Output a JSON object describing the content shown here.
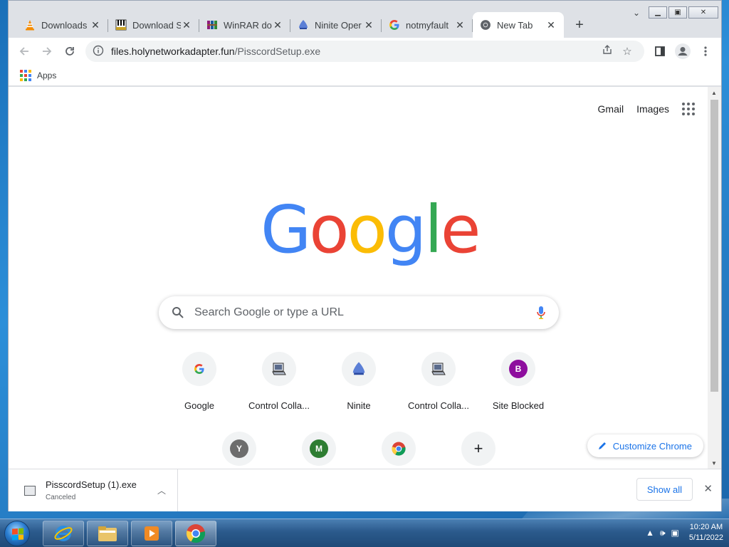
{
  "tabs": [
    {
      "title": "Downloads",
      "icon": "vlc-cone-icon",
      "active": false
    },
    {
      "title": "Download S",
      "icon": "piano-keys-icon",
      "active": false
    },
    {
      "title": "WinRAR dow",
      "icon": "winrar-books-icon",
      "active": false
    },
    {
      "title": "Ninite Oper",
      "icon": "ninite-icon",
      "active": false
    },
    {
      "title": "notmyfault",
      "icon": "google-g-icon",
      "active": false
    },
    {
      "title": "New Tab",
      "icon": "chrome-icon",
      "active": true
    }
  ],
  "tab_close_glyph": "✕",
  "new_tab_glyph": "+",
  "toolbar": {
    "url_host": "files.holynetworkadapter.fun",
    "url_path": "/PisscordSetup.exe"
  },
  "bookmarks": {
    "apps_label": "Apps"
  },
  "ntp": {
    "gmail": "Gmail",
    "images": "Images",
    "logo_letters": [
      "G",
      "o",
      "o",
      "g",
      "l",
      "e"
    ],
    "logo_colors": [
      "#4285F4",
      "#EA4335",
      "#FBBC05",
      "#4285F4",
      "#34A853",
      "#EA4335"
    ],
    "search_placeholder": "Search Google or type a URL",
    "shortcuts_row1": [
      {
        "label": "Google",
        "icon": "google-g-icon"
      },
      {
        "label": "Control Colla...",
        "icon": "monitor-icon"
      },
      {
        "label": "Ninite",
        "icon": "ninite-icon"
      },
      {
        "label": "Control Colla...",
        "icon": "monitor-icon"
      },
      {
        "label": "Site Blocked",
        "icon": "letter-b-icon",
        "letter": "B",
        "color": "#8e0e9e"
      }
    ],
    "shortcuts_row2": [
      {
        "icon": "letter-y-icon",
        "letter": "Y",
        "color": "#6d6d6d"
      },
      {
        "icon": "letter-m-icon",
        "letter": "M",
        "color": "#2e7d32"
      },
      {
        "icon": "chrome-icon"
      },
      {
        "icon": "add-shortcut-icon",
        "glyph": "+"
      }
    ],
    "customize_label": "Customize Chrome"
  },
  "download": {
    "filename": "PisscordSetup (1).exe",
    "status": "Canceled",
    "show_all": "Show all"
  },
  "taskbar": {
    "time": "10:20 AM",
    "date": "5/11/2022"
  },
  "colors": {
    "accent_blue": "#1a73e8",
    "tab_strip": "#dee1e6"
  }
}
